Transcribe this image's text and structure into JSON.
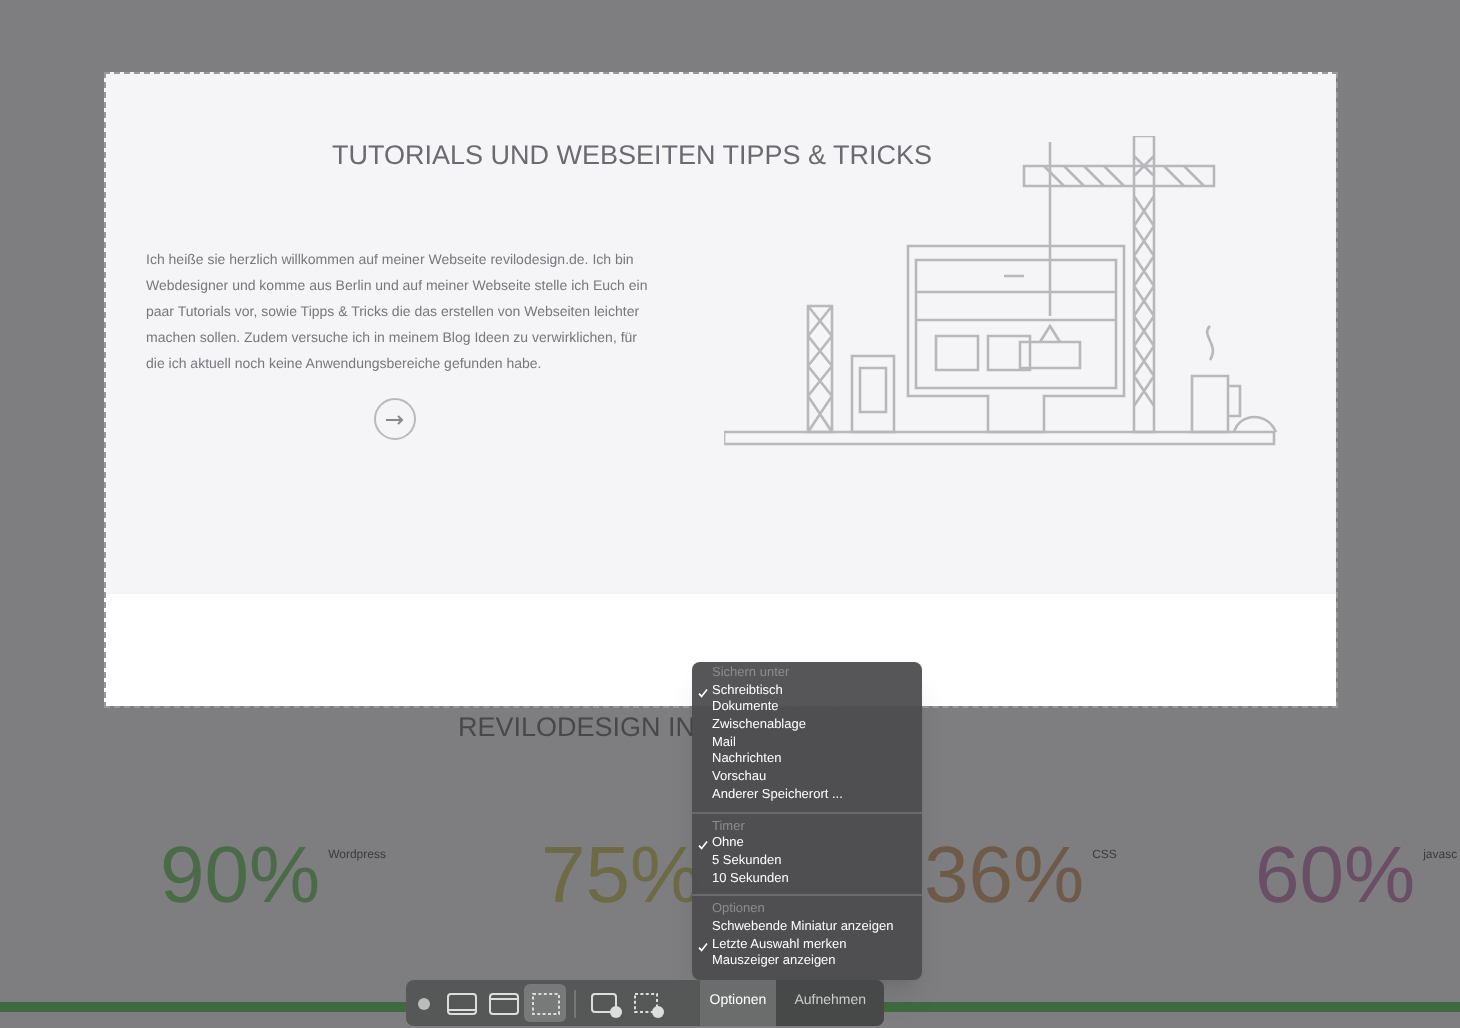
{
  "hero": {
    "title": "TUTORIALS UND WEBSEITEN TIPPS & TRICKS",
    "text": "Ich heiße sie herzlich willkommen auf meiner Webseite revilodesign.de. Ich bin Webdesigner und komme aus Berlin und auf meiner Webseite stelle ich Euch ein paar Tutorials vor, sowie Tipps & Tricks die das erstellen von Webseiten leichter machen sollen. Zudem versuche ich in meinem Blog Ideen zu verwirklichen, für die ich aktuell noch keine Anwendungsbereiche gefunden habe."
  },
  "section_heading": "REVILODESIGN IN",
  "skills": [
    {
      "value": "90%",
      "label": "Wordpress",
      "color": "#4b6b48"
    },
    {
      "value": "75%",
      "color": "#6c6b45"
    },
    {
      "value": "36%",
      "label": "CSS",
      "color": "#6e5a48"
    },
    {
      "value": "60%",
      "label": "javasc",
      "color": "#6a4e63"
    }
  ],
  "menu": {
    "sections": [
      {
        "header": "Sichern unter",
        "items": [
          {
            "label": "Schreibtisch",
            "checked": true
          },
          {
            "label": "Dokumente",
            "checked": false
          },
          {
            "label": "Zwischenablage",
            "checked": false
          },
          {
            "label": "Mail",
            "checked": false
          },
          {
            "label": "Nachrichten",
            "checked": false
          },
          {
            "label": "Vorschau",
            "checked": false
          },
          {
            "label": "Anderer Speicherort ...",
            "checked": false
          }
        ]
      },
      {
        "header": "Timer",
        "items": [
          {
            "label": "Ohne",
            "checked": true
          },
          {
            "label": "5 Sekunden",
            "checked": false
          },
          {
            "label": "10 Sekunden",
            "checked": false
          }
        ]
      },
      {
        "header": "Optionen",
        "items": [
          {
            "label": "Schwebende Miniatur anzeigen",
            "checked": false
          },
          {
            "label": "Letzte Auswahl merken",
            "checked": true
          },
          {
            "label": "Mauszeiger anzeigen",
            "checked": false
          }
        ]
      }
    ]
  },
  "toolbar": {
    "tools": [
      {
        "kind": "screen",
        "selected": false
      },
      {
        "kind": "window",
        "selected": false
      },
      {
        "kind": "selection",
        "selected": true
      },
      {
        "kind": "record-screen",
        "selected": false
      },
      {
        "kind": "record-selection",
        "selected": false
      }
    ],
    "options_button": "Optionen",
    "capture_button": "Aufnehmen"
  }
}
